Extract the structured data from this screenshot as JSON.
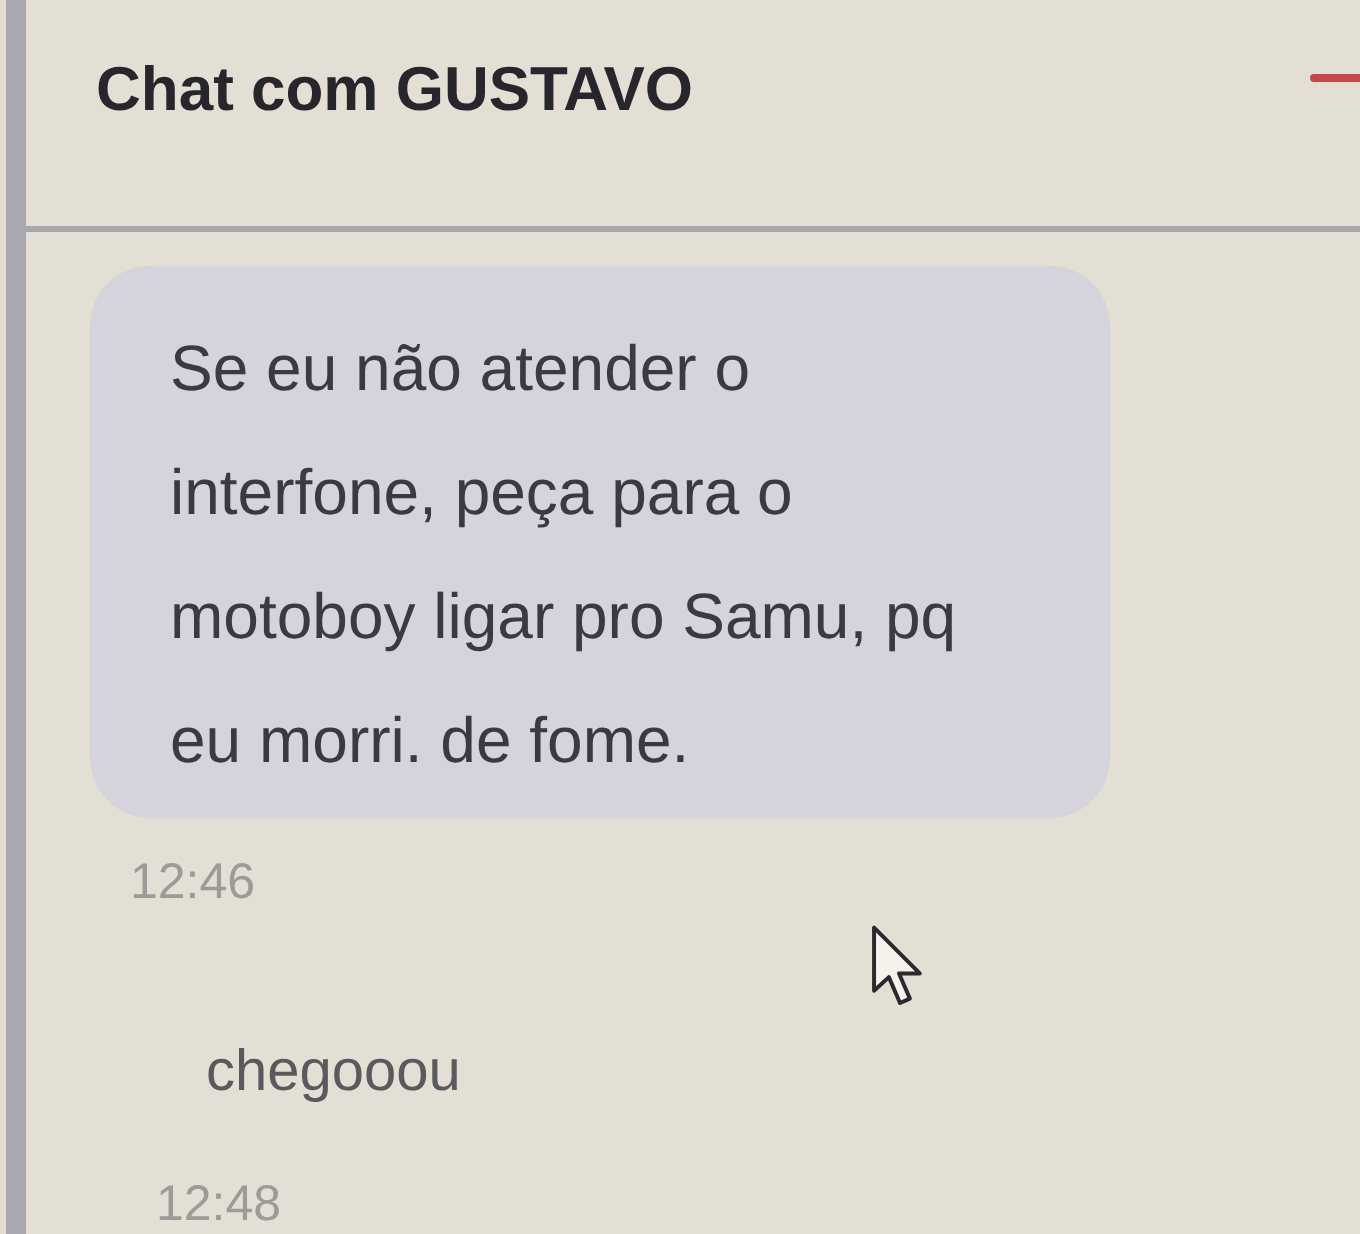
{
  "window": {
    "title": "Chat com GUSTAVO"
  },
  "messages": [
    {
      "kind": "bubble",
      "text": "Se eu não atender o interfone, peça para o motoboy ligar pro Samu, pq eu morri. de fome.",
      "time": "12:46"
    },
    {
      "kind": "plain",
      "text": "chegooou",
      "time": "12:48"
    }
  ]
}
